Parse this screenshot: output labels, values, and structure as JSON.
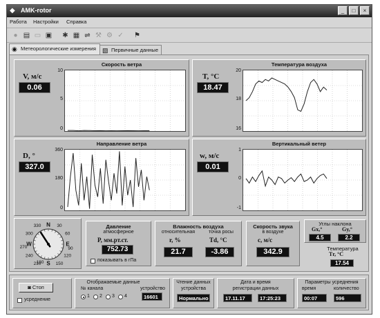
{
  "window": {
    "title": "AMK-rotor"
  },
  "menu": [
    "Работа",
    "Настройки",
    "Справка"
  ],
  "toolbar_icons": [
    "record-icon",
    "new-file-icon",
    "open-icon",
    "save-icon",
    "settings-icon",
    "device-icon",
    "device-connect-icon",
    "tools-icon",
    "gear-icon",
    "check-icon",
    "run-icon"
  ],
  "tabs": [
    {
      "label": "Метеорологические измерения",
      "icon": "meteo-icon",
      "active": true
    },
    {
      "label": "Первичные данные",
      "icon": "data-icon",
      "active": false
    }
  ],
  "panels": {
    "wind_speed": {
      "title": "Скорость ветра",
      "label": "V, м/с",
      "value": "0.06",
      "yticks": [
        "10",
        "5",
        "0"
      ]
    },
    "air_temp": {
      "title": "Температура воздуха",
      "label": "T, °C",
      "value": "18.47",
      "yticks": [
        "20",
        "18",
        "16"
      ]
    },
    "wind_dir": {
      "title": "Направление ветра",
      "label": "D, °",
      "value": "327.0",
      "yticks": [
        "360",
        "180",
        "0"
      ]
    },
    "vert_wind": {
      "title": "Вертикальный ветер",
      "label": "w, м/с",
      "value": "0.01",
      "yticks": [
        "1",
        "0",
        "-1"
      ]
    }
  },
  "compass": {
    "labels": [
      "330",
      "N",
      "30",
      "W",
      "E",
      "60",
      "90",
      "120",
      "150",
      "180",
      "210",
      "240",
      "270",
      "300",
      "S"
    ],
    "direction_deg": 327
  },
  "pressure": {
    "title": "Давление",
    "subtitle": "атмосферное",
    "label": "P, мм.рт.ст.",
    "value": "752.73",
    "hpa_label": "показывать в гПа"
  },
  "humidity": {
    "title": "Влажность воздуха",
    "sub_rel": "относительная",
    "sub_dew": "точка росы",
    "label_r": "r, %",
    "value_r": "21.7",
    "label_td": "Td, °C",
    "value_td": "-3.86"
  },
  "sound": {
    "title": "Скорость звука",
    "subtitle": "в воздухе",
    "label": "c, м/с",
    "value": "342.9"
  },
  "tilt": {
    "title": "Углы наклона",
    "gx_label": "Gx,°",
    "gy_label": "Gy,°",
    "gx": "4.5",
    "gy": "2.2"
  },
  "temp_sensor": {
    "title": "Температура",
    "label": "Tг, °C",
    "value": "17.54"
  },
  "bottom": {
    "stop_button": "Стоп",
    "averaging_label": "усреднение",
    "displayed_data": "Отображаемые данные",
    "channel_label": "№ канала",
    "channels": [
      "1",
      "2",
      "3",
      "4"
    ],
    "device_label": "устройство",
    "device_value": "16601",
    "read_title": "Чтение данных",
    "read_sub": "устройства",
    "read_status": "Нормально",
    "datetime_title": "Дата и время",
    "datetime_sub": "регистрации данных",
    "date": "17.11.17",
    "time": "17:25:23",
    "avg_params": "Параметры усреднения",
    "avg_time_label": "время",
    "avg_count_label": "количество",
    "avg_time": "00:07",
    "avg_count": "596"
  },
  "chart_data": [
    {
      "type": "line",
      "title": "Скорость ветра",
      "ylim": [
        0,
        10
      ],
      "x": [
        0,
        10,
        20,
        30,
        40,
        50,
        60,
        70,
        80,
        90,
        100,
        110,
        120,
        130,
        140,
        150
      ],
      "y": [
        0.1,
        0.1,
        0.05,
        0.1,
        0.08,
        0.06,
        0.07,
        0.05,
        0.06,
        0.05,
        0.06,
        0.07,
        0.06,
        0.05,
        0.06,
        0.06
      ]
    },
    {
      "type": "line",
      "title": "Температура воздуха",
      "ylim": [
        16,
        20
      ],
      "x": [
        0,
        4,
        8,
        12,
        16,
        20,
        24,
        28,
        32,
        36,
        40,
        44,
        48,
        52,
        56,
        60,
        64,
        68,
        72,
        76,
        80,
        84,
        88,
        92,
        96,
        100
      ],
      "y": [
        18.0,
        18.2,
        18.6,
        19.1,
        19.3,
        19.2,
        19.4,
        19.3,
        19.5,
        19.4,
        19.3,
        19.2,
        19.1,
        18.9,
        18.6,
        18.2,
        17.4,
        17.3,
        17.8,
        18.6,
        19.2,
        19.4,
        19.1,
        18.6,
        18.9,
        18.7
      ]
    },
    {
      "type": "line",
      "title": "Направление ветра",
      "ylim": [
        0,
        360
      ],
      "x": [
        0,
        3,
        6,
        9,
        12,
        15,
        18,
        21,
        24,
        27,
        30,
        33,
        36,
        39,
        42,
        45,
        48,
        51,
        54,
        57,
        60,
        63,
        66,
        69,
        72,
        75,
        78,
        81,
        84,
        87,
        90
      ],
      "y": [
        20,
        200,
        340,
        120,
        30,
        280,
        60,
        200,
        10,
        330,
        150,
        80,
        250,
        40,
        300,
        170,
        60,
        220,
        100,
        350,
        30,
        260,
        90,
        180,
        20,
        310,
        140,
        240,
        60,
        200,
        120
      ]
    },
    {
      "type": "line",
      "title": "Вертикальный ветер",
      "ylim": [
        -1,
        1
      ],
      "x": [
        0,
        4,
        8,
        12,
        16,
        20,
        24,
        28,
        32,
        36,
        40,
        44,
        48,
        52,
        56,
        60,
        64,
        68,
        72,
        76,
        80,
        84,
        88,
        92,
        96,
        100
      ],
      "y": [
        0.05,
        -0.1,
        0.1,
        -0.05,
        0.15,
        0.3,
        -0.2,
        0.1,
        0.0,
        -0.15,
        0.1,
        0.05,
        -0.1,
        0.0,
        0.08,
        -0.05,
        0.1,
        0.2,
        -0.05,
        0.0,
        0.1,
        -0.1,
        0.05,
        0.15,
        0.2,
        0.05
      ]
    }
  ]
}
